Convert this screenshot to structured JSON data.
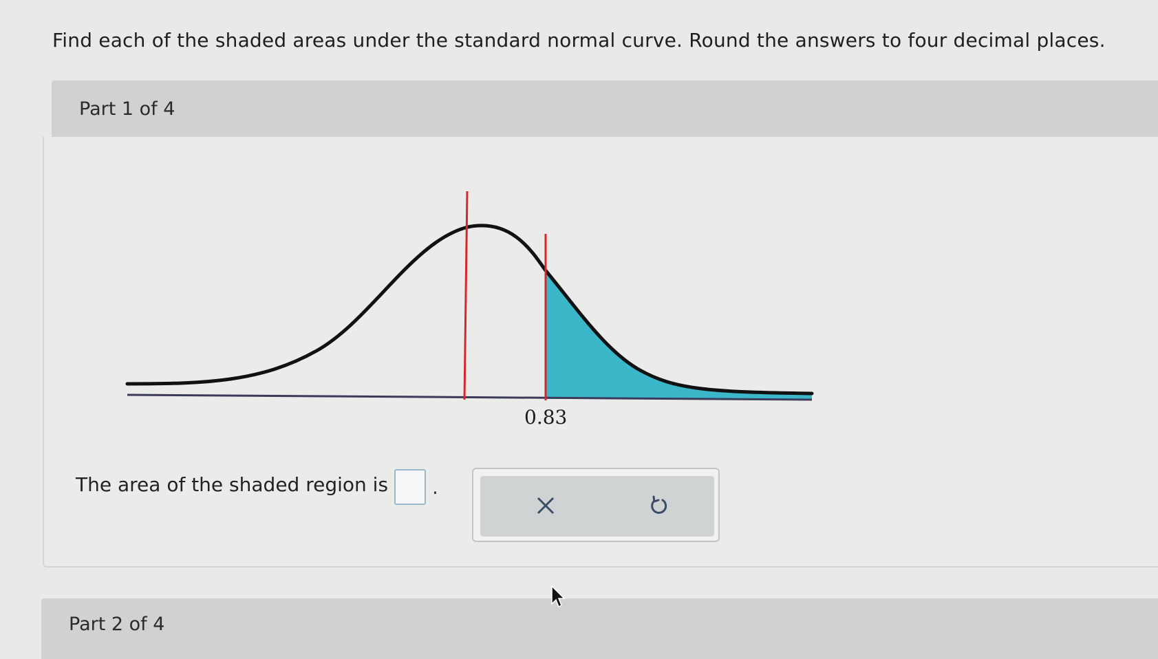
{
  "instructions": "Find each of the shaded areas under the standard normal curve. Round the answers to four decimal places.",
  "part1": {
    "label": "Part 1 of 4",
    "graph": {
      "z_value": 0.83,
      "z_label": "0.83",
      "shaded_region": "right of z",
      "shade_color": "#3bb7c9",
      "marker_color": "#d6262e"
    },
    "question_text": "The area of the shaded region is",
    "answer_value": "",
    "period": ".",
    "tools": [
      {
        "name": "clear",
        "icon": "x-icon"
      },
      {
        "name": "undo",
        "icon": "undo-icon"
      }
    ]
  },
  "part2": {
    "label": "Part 2 of 4"
  }
}
